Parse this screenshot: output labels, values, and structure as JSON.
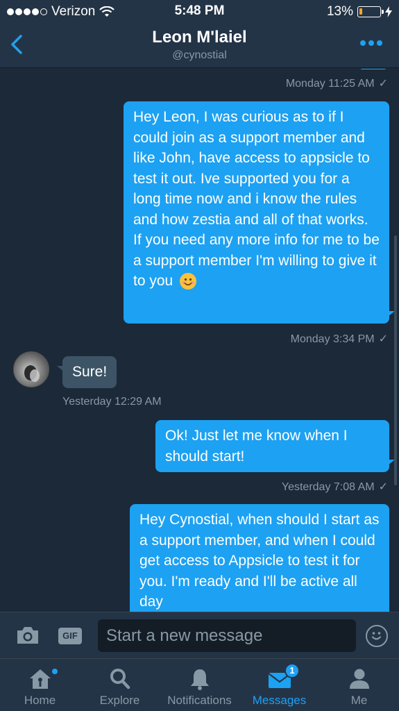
{
  "status_bar": {
    "carrier": "Verizon",
    "time": "5:48 PM",
    "battery_percent": "13%",
    "battery_level": 0.13,
    "battery_color": "#f5a623"
  },
  "header": {
    "title": "Leon M'laiel",
    "handle": "@cynostial",
    "back_icon": "chevron-left-icon",
    "more_icon": "more-dots-icon"
  },
  "thread": {
    "messages": [
      {
        "meta": "Monday 11:25 AM"
      },
      {
        "direction": "sent",
        "text": "Hey Leon, I was curious as to if I could join as a support member and like John, have access to appsicle to test it out. Ive supported you for a long time now and i know the rules and how zestia and all of that works. If you need any more info for me to be a support member I'm willing to give it to you",
        "emoji": "smiling-face-icon",
        "meta": "Monday 3:34 PM"
      },
      {
        "direction": "received",
        "text": "Sure!",
        "meta": "Yesterday 12:29 AM"
      },
      {
        "direction": "sent",
        "text": "Ok! Just let me know when I should start!",
        "meta": "Yesterday 7:08 AM"
      },
      {
        "direction": "sent",
        "text": "Hey Cynostial, when should I start as a support member, and when I could get access to Appsicle to test it for you. I'm ready and I'll be active all day"
      }
    ]
  },
  "composer": {
    "gif_label": "GIF",
    "placeholder": "Start a new message"
  },
  "tabbar": {
    "tabs": [
      {
        "label": "Home",
        "icon": "home-icon"
      },
      {
        "label": "Explore",
        "icon": "search-icon"
      },
      {
        "label": "Notifications",
        "icon": "bell-icon"
      },
      {
        "label": "Messages",
        "icon": "envelope-icon",
        "badge": "1"
      },
      {
        "label": "Me",
        "icon": "person-icon"
      }
    ]
  },
  "colors": {
    "background": "#1c2938",
    "bar": "#243447",
    "accent": "#1da1f2",
    "received_bubble": "#3d5466",
    "muted_text": "#8899a6"
  }
}
